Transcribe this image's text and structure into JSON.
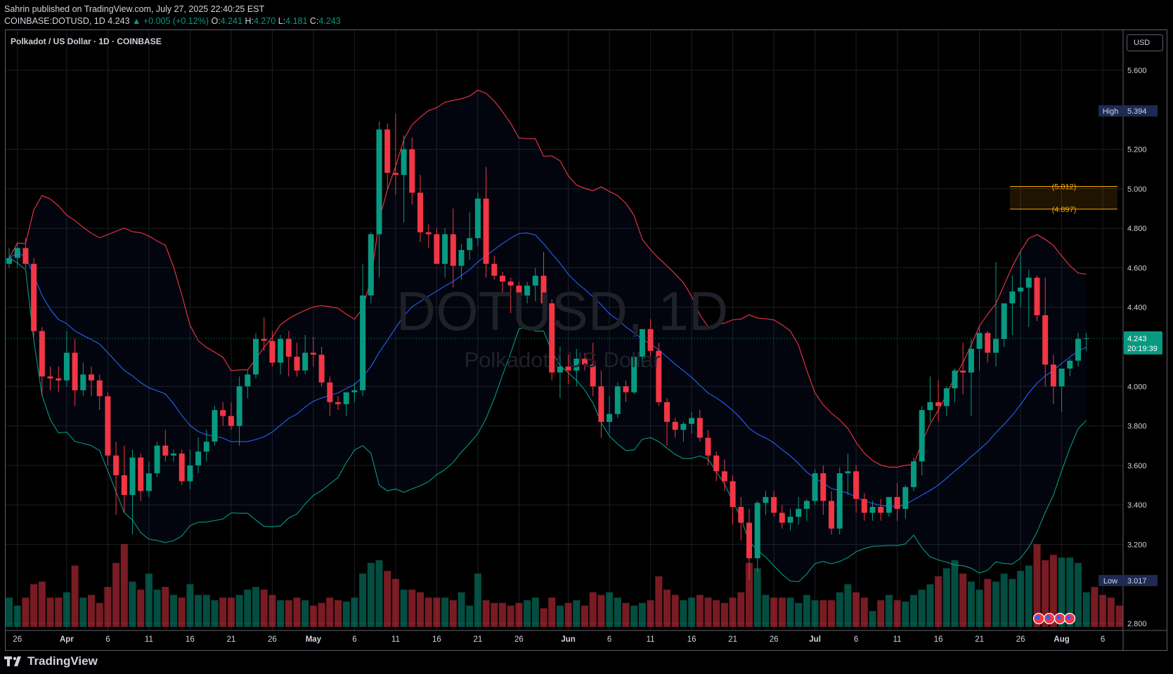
{
  "header": {
    "line1": "Sahrin published on TradingView.com, July 27, 2025 22:40:25 EST",
    "symbol": "COINBASE:DOTUSD, 1D 4.243",
    "change": "▲ +0.005 (+0.12%)",
    "o_label": "O:",
    "o_value": "4.241",
    "h_label": "H:",
    "h_value": "4.270",
    "l_label": "L:",
    "l_value": "4.181",
    "c_label": "C:",
    "c_value": "4.243"
  },
  "legend_title": "Polkadot / US Dollar · 1D · COINBASE",
  "currency": "USD",
  "watermark": {
    "symbol": "DOTUSD, 1D",
    "name": "Polkadot / US Dollar"
  },
  "brand": "TradingView",
  "colors": {
    "up": "#089981",
    "down": "#f23645",
    "bb_upper": "#f23645",
    "bb_lower": "#089981",
    "bb_basis": "#2962ff",
    "fib": "#f7a600"
  },
  "markers": {
    "high_label": "High",
    "high_value": "5.394",
    "low_label": "Low",
    "low_value": "3.017",
    "last_value": "4.243",
    "countdown": "20:19:39"
  },
  "fib": {
    "upper_label": "(5.012)",
    "lower_label": "(4.897)"
  },
  "chart_data": {
    "type": "candlestick",
    "title": "Polkadot / US Dollar · 1D · COINBASE",
    "ylim": [
      2.76,
      5.78
    ],
    "y_ticks": [
      "5.600",
      "5.200",
      "5.000",
      "4.800",
      "4.600",
      "4.400",
      "4.000",
      "3.800",
      "3.600",
      "3.400",
      "3.200",
      "2.800"
    ],
    "x_ticks": [
      "26",
      "Apr",
      "6",
      "11",
      "16",
      "21",
      "26",
      "May",
      "6",
      "11",
      "16",
      "21",
      "26",
      "Jun",
      "6",
      "11",
      "16",
      "21",
      "26",
      "Jul",
      "6",
      "11",
      "16",
      "21",
      "26",
      "Aug",
      "6"
    ],
    "grid": true,
    "dates_start": "2025-03-25",
    "candles": [
      [
        4.62,
        4.7,
        4.6,
        4.65
      ],
      [
        4.65,
        4.73,
        4.6,
        4.7
      ],
      [
        4.7,
        4.75,
        4.6,
        4.62
      ],
      [
        4.62,
        4.65,
        4.25,
        4.28
      ],
      [
        4.28,
        4.3,
        3.95,
        4.05
      ],
      [
        4.05,
        4.1,
        3.98,
        4.04
      ],
      [
        4.04,
        4.1,
        3.97,
        4.03
      ],
      [
        4.03,
        4.28,
        4.0,
        4.17
      ],
      [
        4.17,
        4.24,
        3.9,
        3.98
      ],
      [
        3.98,
        4.12,
        3.95,
        4.06
      ],
      [
        4.06,
        4.1,
        3.95,
        4.03
      ],
      [
        4.03,
        4.06,
        3.88,
        3.95
      ],
      [
        3.95,
        3.97,
        3.6,
        3.65
      ],
      [
        3.65,
        3.72,
        3.35,
        3.55
      ],
      [
        3.55,
        3.7,
        3.36,
        3.45
      ],
      [
        3.45,
        3.68,
        3.25,
        3.64
      ],
      [
        3.64,
        3.66,
        3.42,
        3.47
      ],
      [
        3.47,
        3.62,
        3.44,
        3.56
      ],
      [
        3.56,
        3.72,
        3.54,
        3.7
      ],
      [
        3.7,
        3.78,
        3.62,
        3.65
      ],
      [
        3.65,
        3.68,
        3.62,
        3.66
      ],
      [
        3.66,
        3.68,
        3.5,
        3.52
      ],
      [
        3.52,
        3.68,
        3.48,
        3.6
      ],
      [
        3.6,
        3.74,
        3.56,
        3.67
      ],
      [
        3.67,
        3.78,
        3.62,
        3.72
      ],
      [
        3.72,
        3.9,
        3.7,
        3.88
      ],
      [
        3.88,
        3.92,
        3.8,
        3.85
      ],
      [
        3.85,
        3.92,
        3.78,
        3.8
      ],
      [
        3.8,
        4.05,
        3.7,
        4.0
      ],
      [
        4.0,
        4.08,
        3.94,
        4.06
      ],
      [
        4.06,
        4.27,
        4.04,
        4.24
      ],
      [
        4.24,
        4.35,
        4.18,
        4.23
      ],
      [
        4.23,
        4.28,
        4.1,
        4.12
      ],
      [
        4.12,
        4.26,
        4.06,
        4.24
      ],
      [
        4.24,
        4.28,
        4.05,
        4.15
      ],
      [
        4.15,
        4.22,
        4.05,
        4.08
      ],
      [
        4.08,
        4.26,
        4.06,
        4.17
      ],
      [
        4.17,
        4.25,
        4.1,
        4.16
      ],
      [
        4.16,
        4.2,
        4.0,
        4.02
      ],
      [
        4.02,
        4.05,
        3.85,
        3.92
      ],
      [
        3.92,
        3.95,
        3.88,
        3.91
      ],
      [
        3.91,
        3.94,
        3.85,
        3.97
      ],
      [
        3.97,
        4.02,
        3.92,
        3.98
      ],
      [
        3.98,
        4.62,
        3.95,
        4.46
      ],
      [
        4.46,
        4.78,
        4.42,
        4.77
      ],
      [
        4.77,
        5.34,
        4.55,
        5.3
      ],
      [
        5.3,
        5.33,
        5.0,
        5.08
      ],
      [
        5.08,
        5.38,
        4.97,
        5.07
      ],
      [
        5.07,
        5.27,
        4.83,
        5.2
      ],
      [
        5.2,
        5.26,
        4.92,
        4.98
      ],
      [
        4.98,
        5.07,
        4.73,
        4.78
      ],
      [
        4.78,
        4.82,
        4.7,
        4.77
      ],
      [
        4.77,
        4.8,
        4.62,
        4.62
      ],
      [
        4.62,
        4.8,
        4.55,
        4.77
      ],
      [
        4.77,
        4.9,
        4.5,
        4.61
      ],
      [
        4.61,
        4.72,
        4.54,
        4.69
      ],
      [
        4.69,
        4.88,
        4.64,
        4.75
      ],
      [
        4.75,
        4.98,
        4.71,
        4.95
      ],
      [
        4.95,
        5.11,
        4.55,
        4.62
      ],
      [
        4.62,
        4.66,
        4.54,
        4.56
      ],
      [
        4.56,
        4.58,
        4.47,
        4.53
      ],
      [
        4.53,
        4.55,
        4.37,
        4.51
      ],
      [
        4.51,
        4.53,
        4.42,
        4.46
      ],
      [
        4.46,
        4.53,
        4.42,
        4.51
      ],
      [
        4.51,
        4.6,
        4.43,
        4.56
      ],
      [
        4.56,
        4.68,
        4.4,
        4.42
      ],
      [
        4.42,
        4.44,
        4.03,
        4.07
      ],
      [
        4.07,
        4.2,
        3.94,
        4.1
      ],
      [
        4.1,
        4.16,
        4.01,
        4.08
      ],
      [
        4.08,
        4.19,
        4.0,
        4.14
      ],
      [
        4.14,
        4.17,
        4.08,
        4.11
      ],
      [
        4.11,
        4.22,
        3.95,
        4.0
      ],
      [
        4.0,
        4.08,
        3.74,
        3.82
      ],
      [
        3.82,
        3.95,
        3.76,
        3.86
      ],
      [
        3.86,
        4.02,
        3.84,
        4.0
      ],
      [
        4.0,
        4.03,
        3.92,
        3.97
      ],
      [
        3.97,
        4.17,
        3.96,
        4.15
      ],
      [
        4.15,
        4.26,
        4.1,
        4.29
      ],
      [
        4.29,
        4.34,
        4.15,
        4.18
      ],
      [
        4.18,
        4.22,
        3.9,
        3.92
      ],
      [
        3.92,
        3.94,
        3.7,
        3.82
      ],
      [
        3.82,
        3.84,
        3.74,
        3.78
      ],
      [
        3.78,
        3.82,
        3.72,
        3.81
      ],
      [
        3.81,
        3.87,
        3.76,
        3.84
      ],
      [
        3.84,
        3.88,
        3.72,
        3.74
      ],
      [
        3.74,
        3.78,
        3.6,
        3.65
      ],
      [
        3.65,
        3.67,
        3.52,
        3.57
      ],
      [
        3.57,
        3.63,
        3.47,
        3.52
      ],
      [
        3.52,
        3.55,
        3.3,
        3.39
      ],
      [
        3.39,
        3.44,
        3.22,
        3.31
      ],
      [
        3.31,
        3.38,
        3.02,
        3.13
      ],
      [
        3.13,
        3.42,
        3.06,
        3.41
      ],
      [
        3.41,
        3.47,
        3.35,
        3.44
      ],
      [
        3.44,
        3.47,
        3.34,
        3.36
      ],
      [
        3.36,
        3.4,
        3.28,
        3.31
      ],
      [
        3.31,
        3.38,
        3.27,
        3.34
      ],
      [
        3.34,
        3.44,
        3.3,
        3.38
      ],
      [
        3.38,
        3.43,
        3.32,
        3.42
      ],
      [
        3.42,
        3.58,
        3.4,
        3.56
      ],
      [
        3.56,
        3.6,
        3.35,
        3.42
      ],
      [
        3.42,
        3.47,
        3.25,
        3.28
      ],
      [
        3.28,
        3.59,
        3.25,
        3.56
      ],
      [
        3.56,
        3.66,
        3.45,
        3.57
      ],
      [
        3.57,
        3.6,
        3.36,
        3.43
      ],
      [
        3.43,
        3.46,
        3.32,
        3.36
      ],
      [
        3.36,
        3.42,
        3.32,
        3.39
      ],
      [
        3.39,
        3.43,
        3.32,
        3.36
      ],
      [
        3.36,
        3.44,
        3.34,
        3.44
      ],
      [
        3.44,
        3.51,
        3.32,
        3.38
      ],
      [
        3.38,
        3.5,
        3.33,
        3.49
      ],
      [
        3.49,
        3.64,
        3.47,
        3.62
      ],
      [
        3.62,
        3.9,
        3.55,
        3.88
      ],
      [
        3.88,
        4.05,
        3.82,
        3.92
      ],
      [
        3.92,
        4.03,
        3.82,
        3.9
      ],
      [
        3.9,
        4.0,
        3.85,
        3.99
      ],
      [
        3.99,
        4.09,
        3.92,
        4.08
      ],
      [
        4.08,
        4.22,
        3.96,
        4.07
      ],
      [
        4.07,
        4.24,
        3.85,
        4.19
      ],
      [
        4.19,
        4.3,
        4.08,
        4.27
      ],
      [
        4.27,
        4.28,
        4.12,
        4.17
      ],
      [
        4.17,
        4.63,
        4.1,
        4.24
      ],
      [
        4.24,
        4.4,
        4.2,
        4.42
      ],
      [
        4.42,
        4.56,
        4.26,
        4.48
      ],
      [
        4.48,
        4.68,
        4.4,
        4.5
      ],
      [
        4.5,
        4.59,
        4.3,
        4.55
      ],
      [
        4.55,
        4.56,
        4.33,
        4.36
      ],
      [
        4.36,
        4.55,
        4.0,
        4.11
      ],
      [
        4.11,
        4.16,
        3.91,
        4.0
      ],
      [
        4.0,
        4.08,
        3.87,
        4.09
      ],
      [
        4.09,
        4.14,
        4.05,
        4.13
      ],
      [
        4.13,
        4.27,
        4.1,
        4.24
      ],
      [
        4.24,
        4.27,
        4.18,
        4.243
      ]
    ],
    "volume": [
      110,
      80,
      110,
      160,
      170,
      110,
      110,
      130,
      230,
      110,
      120,
      90,
      150,
      240,
      310,
      170,
      140,
      200,
      140,
      150,
      120,
      110,
      160,
      120,
      120,
      100,
      110,
      110,
      120,
      140,
      150,
      140,
      120,
      100,
      100,
      110,
      100,
      80,
      90,
      110,
      100,
      95,
      110,
      200,
      240,
      250,
      210,
      180,
      140,
      140,
      130,
      110,
      110,
      110,
      100,
      130,
      80,
      200,
      100,
      90,
      90,
      80,
      90,
      100,
      110,
      70,
      110,
      80,
      90,
      100,
      80,
      130,
      120,
      130,
      110,
      90,
      80,
      90,
      100,
      190,
      140,
      120,
      100,
      110,
      120,
      110,
      100,
      90,
      110,
      130,
      240,
      220,
      120,
      110,
      110,
      110,
      90,
      120,
      100,
      100,
      100,
      130,
      160,
      130,
      110,
      60,
      100,
      120,
      100,
      95,
      120,
      140,
      160,
      190,
      220,
      250,
      200,
      170,
      140,
      180,
      170,
      200,
      180,
      210,
      230,
      310,
      250,
      270,
      260,
      260,
      240,
      130,
      150,
      120,
      110,
      80
    ],
    "bollinger": {
      "period": 20,
      "upper_line_color": "#f23645",
      "lower_line_color": "#089981",
      "basis_line_color": "#2962ff"
    },
    "horizontal_levels": [
      5.012,
      4.897
    ],
    "high": 5.394,
    "low": 3.017,
    "last": 4.243
  }
}
